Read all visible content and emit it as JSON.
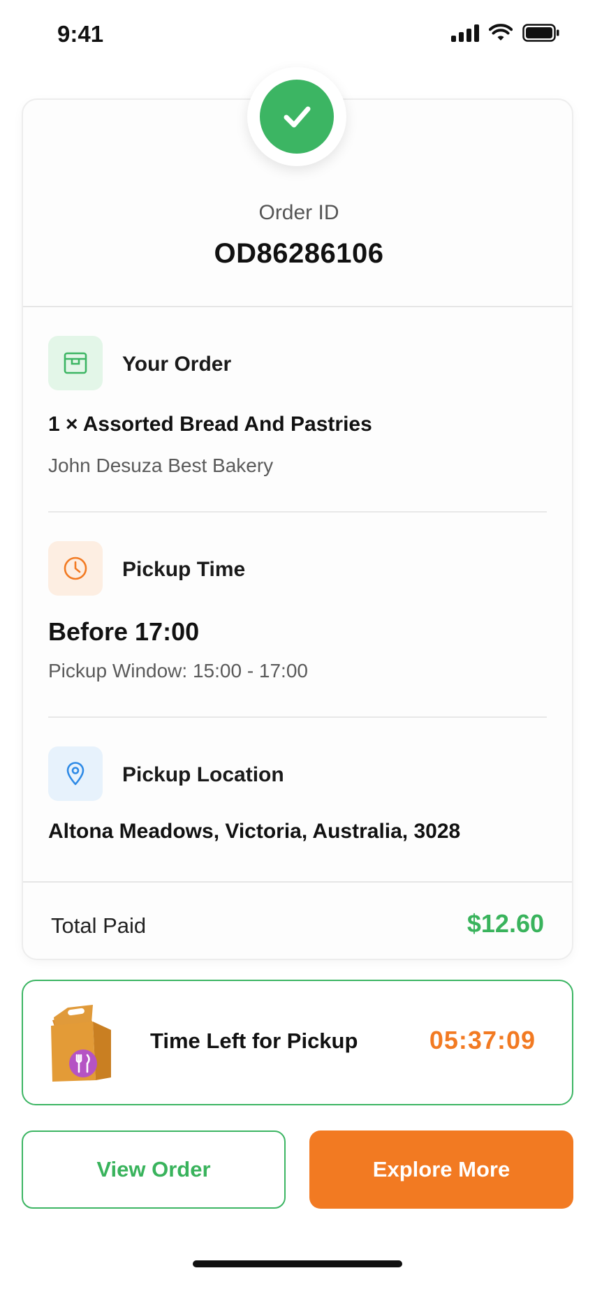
{
  "status_bar": {
    "time": "9:41"
  },
  "order": {
    "id_label": "Order ID",
    "id_value": "OD86286106"
  },
  "your_order": {
    "title": "Your Order",
    "item": "1 × Assorted Bread And Pastries",
    "store": "John Desuza Best Bakery",
    "icon": "box-icon"
  },
  "pickup_time": {
    "title": "Pickup Time",
    "value": "Before 17:00",
    "window": "Pickup Window: 15:00 - 17:00",
    "icon": "clock-icon"
  },
  "pickup_location": {
    "title": "Pickup Location",
    "address": "Altona Meadows, Victoria, Australia, 3028",
    "icon": "location-pin-icon"
  },
  "total": {
    "label": "Total Paid",
    "value": "$12.60"
  },
  "timer": {
    "label": "Time Left for Pickup",
    "value": "05:37:09"
  },
  "buttons": {
    "view_order": "View Order",
    "explore_more": "Explore More"
  },
  "colors": {
    "success_green": "#3cb563",
    "accent_orange": "#f27a22",
    "location_blue": "#2e8ae6"
  }
}
